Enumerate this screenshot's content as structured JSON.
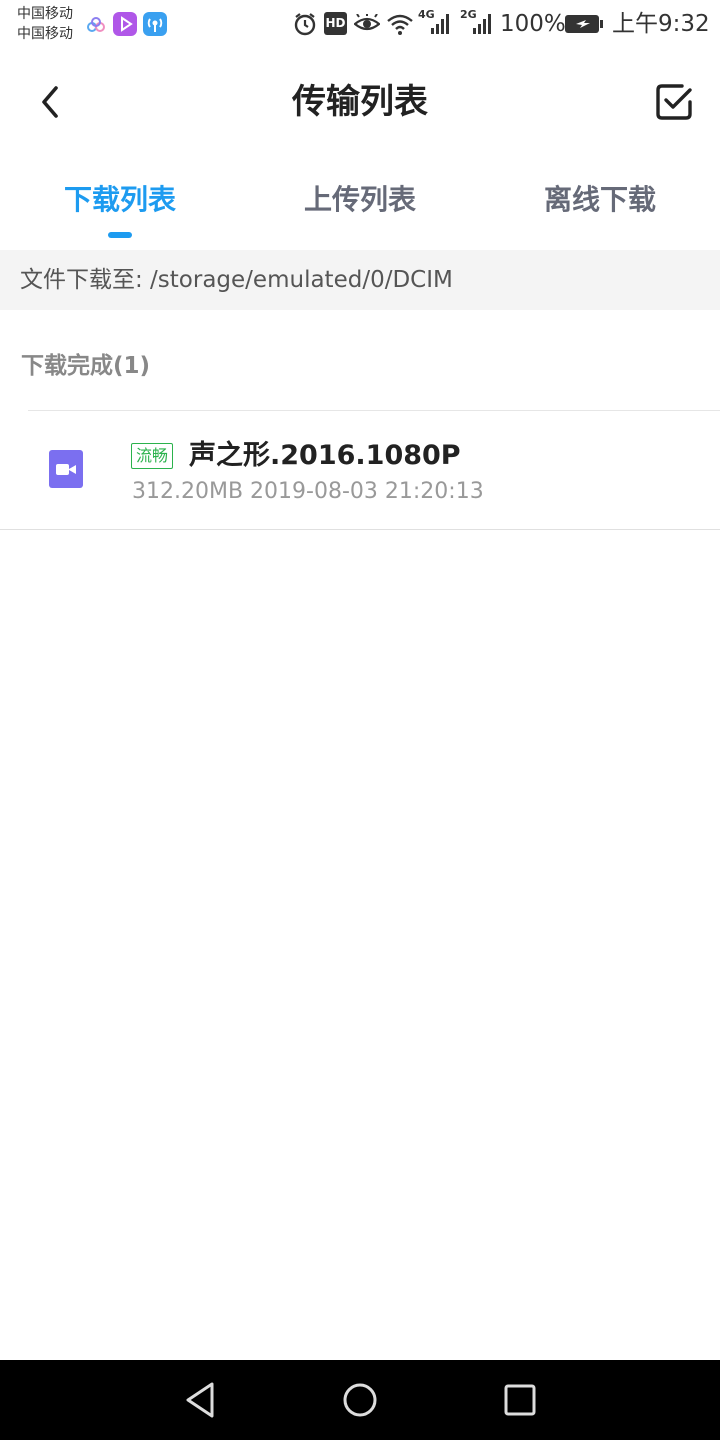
{
  "status_bar": {
    "carrier1": "中国移动",
    "carrier2": "中国移动",
    "battery": "100%",
    "time": "上午9:32",
    "net1": "4G",
    "net2": "2G",
    "hd": "HD",
    "icons": [
      "cloud-icon",
      "video-app-icon",
      "hotspot-icon",
      "alarm-icon",
      "hd-icon",
      "eye-icon",
      "wifi-icon",
      "signal-icon",
      "signal-icon",
      "battery-icon"
    ]
  },
  "header": {
    "title": "传输列表",
    "back_icon": "chevron-left-icon",
    "select_icon": "checkbox-icon"
  },
  "tabs": [
    {
      "label": "下载列表",
      "active": true
    },
    {
      "label": "上传列表",
      "active": false
    },
    {
      "label": "离线下载",
      "active": false
    }
  ],
  "download_path": "文件下载至: /storage/emulated/0/DCIM",
  "section": {
    "title": "下载完成(1)"
  },
  "files": [
    {
      "icon": "video-file-icon",
      "quality": "流畅",
      "name": "声之形.2016.1080P",
      "meta": "312.20MB 2019-08-03 21:20:13"
    }
  ],
  "nav_bar": {
    "back": "triangle-back-icon",
    "home": "circle-home-icon",
    "recents": "square-recents-icon"
  },
  "colors": {
    "accent": "#1d9bf0",
    "badge": "#2bb24c",
    "file_icon": "#7b6ff0"
  }
}
